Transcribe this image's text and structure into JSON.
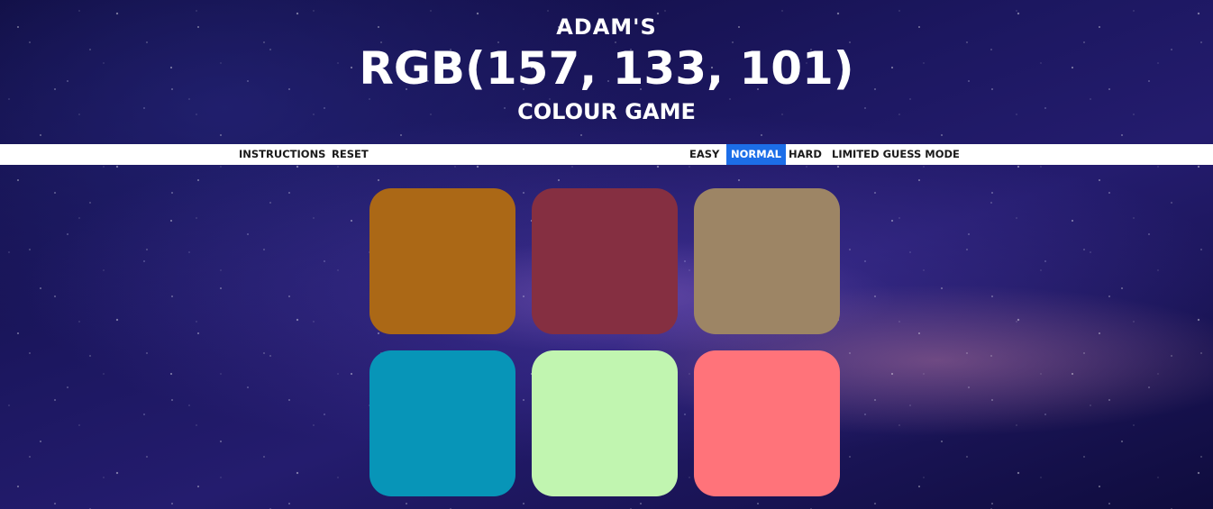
{
  "header": {
    "owner": "ADAM'S",
    "target_rgb": "RGB(157, 133, 101)",
    "game_name": "COLOUR GAME"
  },
  "nav": {
    "instructions": "INSTRUCTIONS",
    "reset": "RESET",
    "modes": [
      {
        "label": "EASY",
        "selected": false
      },
      {
        "label": "NORMAL",
        "selected": true
      },
      {
        "label": "HARD",
        "selected": false
      },
      {
        "label": "LIMITED GUESS MODE",
        "selected": false
      }
    ],
    "selected_color": "#1c6ee8"
  },
  "squares": [
    {
      "color": "#ab6816"
    },
    {
      "color": "#852f41"
    },
    {
      "color": "#9d8565"
    },
    {
      "color": "#0795b8"
    },
    {
      "color": "#c1f5b0"
    },
    {
      "color": "#ff737a"
    }
  ]
}
